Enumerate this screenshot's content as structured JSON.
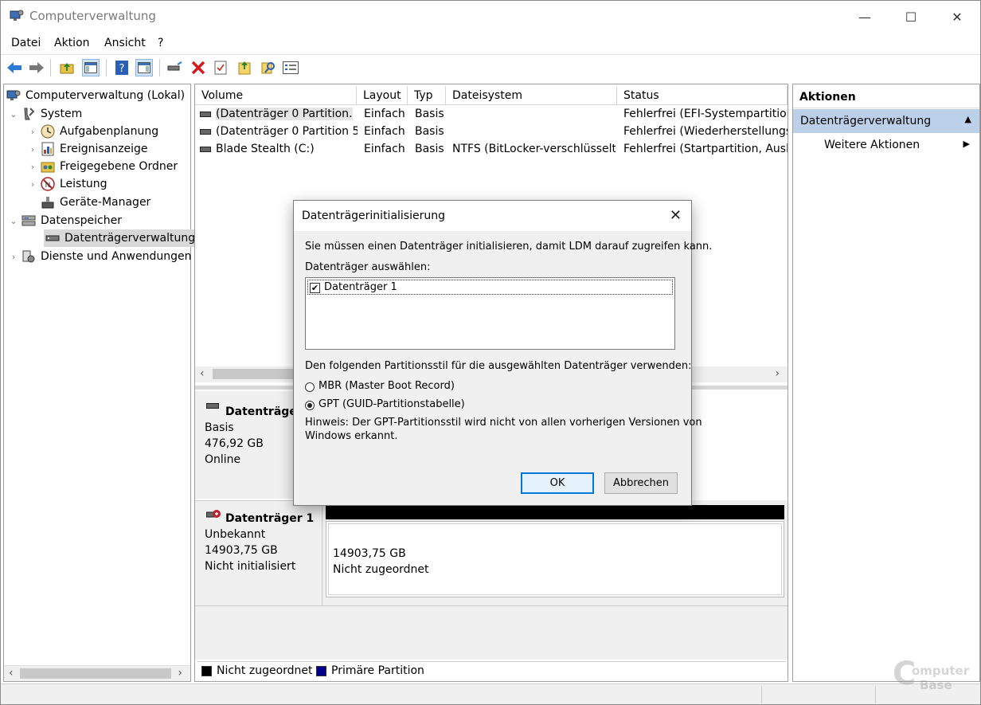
{
  "window": {
    "title": "Computerverwaltung",
    "minimize": "—",
    "maximize": "☐",
    "close": "✕"
  },
  "menu": [
    "Datei",
    "Aktion",
    "Ansicht",
    "?"
  ],
  "tree": {
    "root": "Computerverwaltung (Lokal)",
    "items": [
      {
        "label": "System",
        "expander": "⌄"
      },
      {
        "label": "Aufgabenplanung",
        "expander": "›"
      },
      {
        "label": "Ereignisanzeige",
        "expander": "›"
      },
      {
        "label": "Freigegebene Ordner",
        "expander": "›"
      },
      {
        "label": "Leistung",
        "expander": "›"
      },
      {
        "label": "Geräte-Manager",
        "expander": ""
      },
      {
        "label": "Datenspeicher",
        "expander": "⌄"
      },
      {
        "label": "Datenträgerverwaltung",
        "expander": ""
      },
      {
        "label": "Dienste und Anwendungen",
        "expander": "›"
      }
    ],
    "scroll_left": "‹",
    "scroll_right": "›"
  },
  "volumes": {
    "columns": [
      "Volume",
      "Layout",
      "Typ",
      "Dateisystem",
      "Status"
    ],
    "rows": [
      [
        "(Datenträger 0 Partition…",
        "Einfach",
        "Basis",
        "",
        "Fehlerfrei (EFI-Systempartition)"
      ],
      [
        "(Datenträger 0 Partition 5)",
        "Einfach",
        "Basis",
        "",
        "Fehlerfrei (Wiederherstellungsp"
      ],
      [
        "Blade Stealth (C:)",
        "Einfach",
        "Basis",
        "NTFS (BitLocker-verschlüsselt)",
        "Fehlerfrei (Startpartition, Auslag"
      ]
    ],
    "scroll_left": "‹",
    "scroll_right": "›"
  },
  "disk0": {
    "name": "Datenträger",
    "type": "Basis",
    "size": "476,92 GB",
    "state": "Online"
  },
  "disk1": {
    "name": "Datenträger 1",
    "type": "Unbekannt",
    "size": "14903,75 GB",
    "state": "Nicht initialisiert",
    "partition_size": "14903,75 GB",
    "partition_state": "Nicht zugeordnet"
  },
  "legend": {
    "unallocated": "Nicht zugeordnet",
    "primary": "Primäre Partition",
    "unallocated_color": "#000000",
    "primary_color": "#00008b"
  },
  "actions": {
    "header": "Aktionen",
    "section": "Datenträgerverwaltung",
    "section_arrow": "▲",
    "more": "Weitere Aktionen",
    "more_arrow": "▶"
  },
  "dialog": {
    "title": "Datenträgerinitialisierung",
    "close": "✕",
    "intro": "Sie müssen einen Datenträger initialisieren, damit LDM darauf zugreifen kann.",
    "select_label": "Datenträger auswählen:",
    "disk_item": "Datenträger 1",
    "disk_checked": "✔",
    "style_label": "Den folgenden Partitionsstil für die ausgewählten Datenträger verwenden:",
    "mbr": "MBR (Master Boot Record)",
    "gpt": "GPT (GUID-Partitionstabelle)",
    "hint_line1": "Hinweis: Der GPT-Partitionsstil wird nicht von allen vorherigen Versionen von",
    "hint_line2": "Windows erkannt.",
    "ok": "OK",
    "cancel": "Abbrechen"
  },
  "colors": {
    "accent": "#0078d7",
    "selection": "#d9d9d9",
    "actions_selected": "#bcd0ea"
  },
  "watermark": "ComputerBase"
}
